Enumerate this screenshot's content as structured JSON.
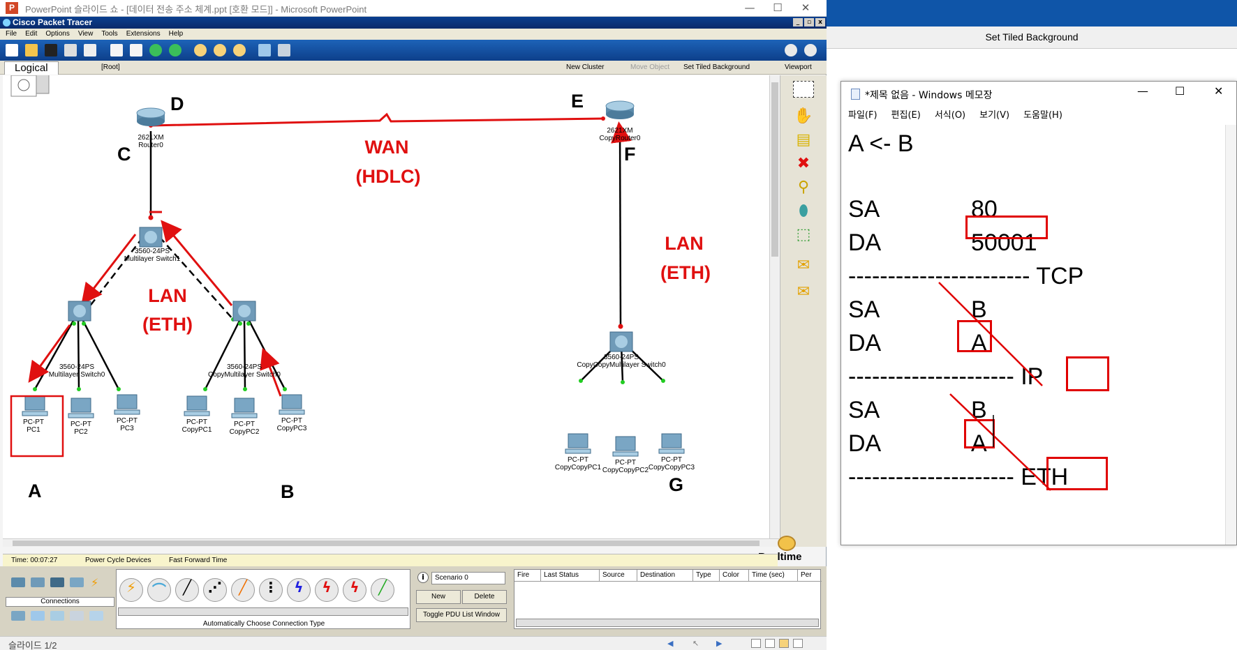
{
  "ppt_window": {
    "title": "PowerPoint 슬라이드 쇼 - [데이터 전송 주소 체계.ppt [호환 모드]] - Microsoft PowerPoint",
    "slide_indicator": "슬라이드 1/2"
  },
  "packet_tracer": {
    "title": "Cisco Packet Tracer",
    "menu": [
      "File",
      "Edit",
      "Options",
      "View",
      "Tools",
      "Extensions",
      "Help"
    ],
    "bar2": {
      "tab": "Logical",
      "root": "[Root]",
      "new_cluster": "New Cluster",
      "move_object": "Move Object",
      "set_tiled_bg": "Set Tiled Background",
      "viewport": "Viewport"
    },
    "status": {
      "time": "Time: 00:07:27",
      "power_cycle": "Power Cycle Devices",
      "fast_forward": "Fast Forward Time"
    },
    "realtime": "Realtime",
    "bottom": {
      "connections": "Connections",
      "auto_connection": "Automatically Choose Connection Type",
      "scenario": "Scenario 0",
      "new": "New",
      "delete": "Delete",
      "toggle_pdu": "Toggle PDU List Window",
      "columns": [
        "Fire",
        "Last Status",
        "Source",
        "Destination",
        "Type",
        "Color",
        "Time (sec)",
        "Per"
      ]
    }
  },
  "topology": {
    "devices": {
      "router0": [
        "2621XM",
        "Router0"
      ],
      "copyrouter0": [
        "2621XM",
        "CopyRouter0"
      ],
      "mls1": [
        "3560-24PS",
        "Multilayer Switch1"
      ],
      "mls0": [
        "3560-24PS",
        "Multilayer Switch0"
      ],
      "copymls0": [
        "3560-24PS",
        "CopyMultilayer Switch0"
      ],
      "copycopymls0": [
        "3560-24PS",
        "CopyCopyMultilayer Switch0"
      ],
      "pc1": [
        "PC-PT",
        "PC1"
      ],
      "pc2": [
        "PC-PT",
        "PC2"
      ],
      "pc3": [
        "PC-PT",
        "PC3"
      ],
      "copypc1": [
        "PC-PT",
        "CopyPC1"
      ],
      "copypc2": [
        "PC-PT",
        "CopyPC2"
      ],
      "copypc3": [
        "PC-PT",
        "CopyPC3"
      ],
      "ccpc1": [
        "PC-PT",
        "CopyCopyPC1"
      ],
      "ccpc2": [
        "PC-PT",
        "CopyCopyPC2"
      ],
      "ccpc3": [
        "PC-PT",
        "CopyCopyPC3"
      ]
    },
    "letters": {
      "a": "A",
      "b": "B",
      "c": "C",
      "d": "D",
      "e": "E",
      "f": "F",
      "g": "G"
    },
    "annotations": {
      "wan1": "WAN",
      "wan2": "(HDLC)",
      "lan_left1": "LAN",
      "lan_left2": "(ETH)",
      "lan_right1": "LAN",
      "lan_right2": "(ETH)"
    }
  },
  "set_tiled_background_bar": "Set Tiled Background",
  "notepad": {
    "title": "*제목 없음 - Windows 메모장",
    "menu": [
      "파일(F)",
      "편집(E)",
      "서식(O)",
      "보기(V)",
      "도움말(H)"
    ],
    "lines": {
      "l1": "A <- B",
      "sa1_label": "SA",
      "sa1_value": "80",
      "da1_label": "DA",
      "da1_value": "50001",
      "sep1": "----------------------- TCP",
      "sa2_label": "SA",
      "sa2_value": "B",
      "da2_label": "DA",
      "da2_value": "A",
      "sep2": "--------------------- IP",
      "sa3_label": "SA",
      "sa3_value": "B",
      "da3_label": "DA",
      "da3_value": "A",
      "sep3": "--------------------- ETH"
    }
  },
  "colors": {
    "annotation_red": "#e01010",
    "pt_toolbar_blue": "#1d63b8",
    "banner_blue": "#0f55a8"
  }
}
